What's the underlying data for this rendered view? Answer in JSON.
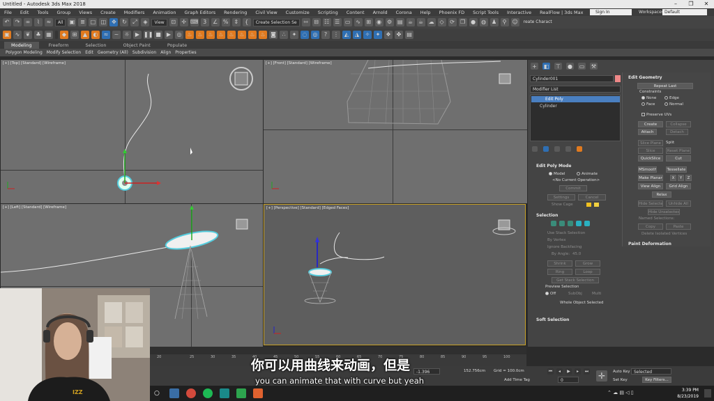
{
  "window": {
    "title": "Untitled - Autodesk 3ds Max 2018",
    "controls": [
      "–",
      "❐",
      "✕"
    ]
  },
  "menu": [
    "File",
    "Edit",
    "Tools",
    "Group",
    "Views",
    "Create",
    "Modifiers",
    "Animation",
    "Graph Editors",
    "Rendering",
    "Civil View",
    "Customize",
    "Scripting",
    "Content",
    "Arnold",
    "Corona",
    "Help",
    "Phoenix FD",
    "Script Tools",
    "Interactive",
    "RealFlow | 3ds Max"
  ],
  "account": {
    "signin": "Sign In",
    "workspaces_label": "Workspaces:",
    "workspace": "Default"
  },
  "toolbar": {
    "filter": "All",
    "ref_coord": "View",
    "selection_set": "Create Selection Se",
    "create_character": "reate Charact"
  },
  "ribbon": {
    "tabs": [
      "Modeling",
      "Freeform",
      "Selection",
      "Object Paint",
      "Populate"
    ],
    "active_tab": "Modeling",
    "sub": [
      "Polygon Modeling",
      "Modify Selection",
      "Edit",
      "Geometry (All)",
      "Subdivision",
      "Align",
      "Properties"
    ]
  },
  "viewports": {
    "top": "[+] [Top] [Standard] [Wireframe]",
    "front": "[+] [Front] [Standard] [Wireframe]",
    "left": "[+] [Left] [Standard] [Wireframe]",
    "perspective": "[+] [Perspective] [Standard] [Edged Faces]"
  },
  "command_panel": {
    "object_name": "Cylinder001",
    "modifier_list": "Modifier List",
    "stack": [
      "Edit Poly",
      "Cylinder"
    ],
    "edit_poly_mode": {
      "title": "Edit Poly Mode",
      "model": "Model",
      "animate": "Animate",
      "current_op": "<No Current Operation>",
      "commit": "Commit",
      "settings": "Settings",
      "cancel": "Cancel",
      "show_cage": "Show Cage"
    },
    "selection": {
      "title": "Selection",
      "use_stack": "Use Stack Selection",
      "by_vertex": "By Vertex",
      "ignore_backfacing": "Ignore Backfacing",
      "by_angle": "By Angle:",
      "angle_value": "45.0",
      "shrink": "Shrink",
      "grow": "Grow",
      "ring": "Ring",
      "loop": "Loop",
      "get_stack": "Get Stack Selection",
      "preview": "Preview Selection",
      "off": "Off",
      "subobj": "SubObj",
      "multi": "Multi",
      "whole": "Whole Object Selected"
    },
    "soft_selection": "Soft Selection",
    "edit_geometry": {
      "title": "Edit Geometry",
      "repeat_last": "Repeat Last",
      "constraints": "Constraints",
      "none": "None",
      "edge": "Edge",
      "face": "Face",
      "normal": "Normal",
      "preserve_uvs": "Preserve UVs",
      "create": "Create",
      "collapse": "Collapse",
      "attach": "Attach",
      "detach": "Detach",
      "slice_plane": "Slice Plane",
      "split": "Split",
      "slice": "Slice",
      "reset_plane": "Reset Plane",
      "quickslice": "QuickSlice",
      "cut": "Cut",
      "msmooth": "MSmooth",
      "tessellate": "Tessellate",
      "make_planar": "Make Planar",
      "x": "X",
      "y": "Y",
      "z": "Z",
      "view_align": "View Align",
      "grid_align": "Grid Align",
      "relax": "Relax",
      "hide_selected": "Hide Selected",
      "unhide_all": "Unhide All",
      "hide_unselected": "Hide Unselected",
      "named_selections": "Named Selections:",
      "copy": "Copy",
      "paste": "Paste",
      "delete_isolated": "Delete Isolated Vertices"
    },
    "paint_deformation": "Paint Deformation"
  },
  "timeline": {
    "ticks": [
      "20",
      "25",
      "30",
      "35",
      "40",
      "45",
      "50",
      "55",
      "60",
      "65",
      "70",
      "75",
      "80",
      "85",
      "90",
      "95",
      "100"
    ]
  },
  "status": {
    "coord_y": "-1.396",
    "coord_z": "152.756cm",
    "grid": "Grid = 100.0cm",
    "add_time_tag": "Add Time Tag",
    "auto_key": "Auto Key",
    "set_key": "Set Key",
    "selected": "Selected",
    "key_filters": "Key Filters...",
    "frame": "0"
  },
  "subtitles": {
    "cn": "你可以用曲线来动画，但是",
    "en": "you can animate that with curve but yeah"
  },
  "clock": {
    "time": "3:39 PM",
    "date": "8/23/2019"
  }
}
